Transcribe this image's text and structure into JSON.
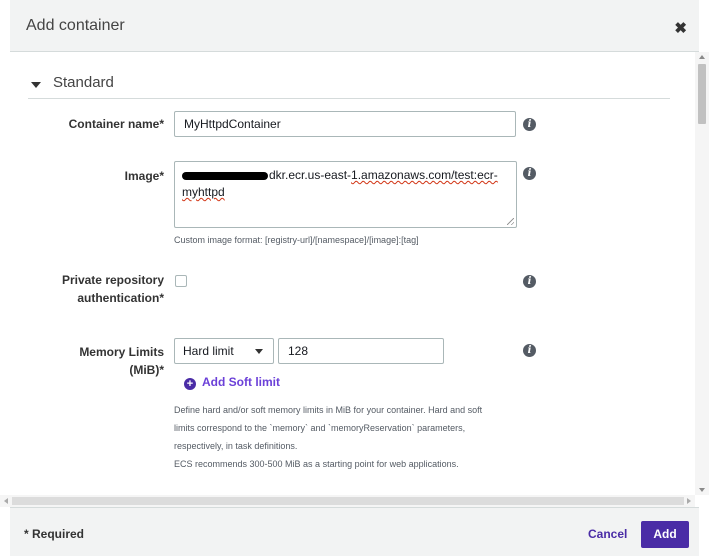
{
  "dialog": {
    "title": "Add container",
    "close_symbol": "✖"
  },
  "section": {
    "title": "Standard"
  },
  "fields": {
    "container_name": {
      "label": "Container name*",
      "value": "MyHttpdContainer"
    },
    "image": {
      "label": "Image*",
      "value_visible_part1": "dkr.ecr.us-east-",
      "value_visible_part2": "1.amazonaws.com/test:ecr-",
      "value_line2": "myhttpd",
      "help": "Custom image format: [registry-url]/[namespace]/[image]:[tag]"
    },
    "private_repo": {
      "label_line1": "Private repository",
      "label_line2": "authentication*",
      "checked": false
    },
    "memory_limits": {
      "label_line1": "Memory Limits",
      "label_line2": "(MiB)*",
      "limit_type": "Hard limit",
      "value": "128",
      "add_soft_limit": "Add Soft limit",
      "help_line1": "Define hard and/or soft memory limits in MiB for your container. Hard and soft",
      "help_line2": "limits correspond to the `memory` and `memoryReservation` parameters,",
      "help_line3": "respectively, in task definitions.",
      "help_line4": "ECS recommends 300-500 MiB as a starting point for web applications."
    }
  },
  "footer": {
    "required_note": "* Required",
    "cancel_label": "Cancel",
    "add_label": "Add"
  },
  "icons": {
    "info": "i",
    "plus": "+"
  },
  "colors": {
    "primary": "#4a2ca6",
    "link": "#6b40d8",
    "header_bg": "#f2f3f3",
    "border": "#aab7b8"
  }
}
